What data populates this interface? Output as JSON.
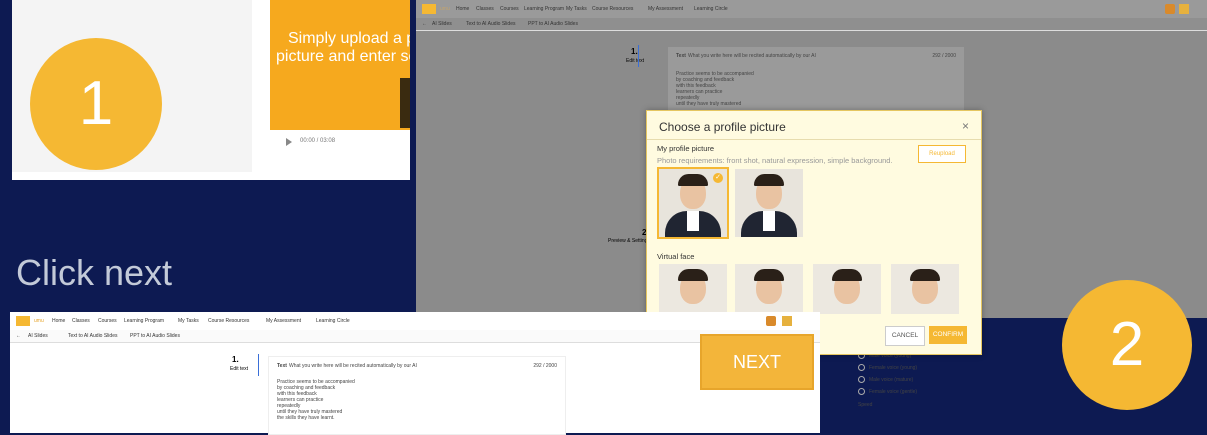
{
  "steps": {
    "one": "1",
    "two": "2"
  },
  "instruction": "Click next",
  "video": {
    "line1": "Simply upload a pro",
    "line2": "picture and enter som",
    "time": "00:00 / 03:08"
  },
  "nav": {
    "logo_text": "umu",
    "items": [
      "Home",
      "Classes",
      "Courses",
      "Learning Program",
      "My Tasks",
      "Course Resources",
      "My Assessment",
      "Learning Circle"
    ],
    "badge": "99+"
  },
  "subnav": {
    "back": "AI Slides",
    "tab1": "Text to AI Audio Slides",
    "tab2": "PPT to AI Audio Slides"
  },
  "editor": {
    "step1_num": "1.",
    "step1_label": "Edit text",
    "step2_num": "2.",
    "step2_label": "Preview & Settings",
    "text_label": "Text",
    "text_hint": "What you write here will be recited automatically by our AI",
    "count": "292 / 2000",
    "lines": [
      "Practice seems to be accompanied",
      "by coaching and feedback",
      "with this feedback",
      "learners can practice",
      "repeatedly",
      "until they have truly mastered",
      "the skills they have learnt."
    ]
  },
  "modal": {
    "title": "Choose a profile picture",
    "close": "×",
    "my_profile": "My profile picture",
    "requirements": "Photo requirements: front shot, natural expression, simple background.",
    "reupload": "Reupload",
    "virtual_face": "Virtual face",
    "cancel": "CANCEL",
    "confirm": "CONFIRM"
  },
  "voice": {
    "options": [
      "Male voice (young)",
      "Female voice (young)",
      "Male voice (mature)",
      "Female voice (gentle)"
    ],
    "speed": "Speed"
  },
  "next_button": "NEXT",
  "colors": {
    "accent": "#f5b833",
    "background": "#0d1a52"
  }
}
